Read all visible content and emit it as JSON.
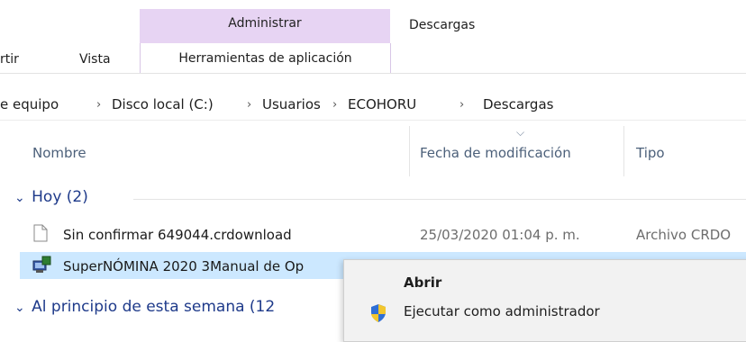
{
  "ribbon": {
    "tab_partial": "rtir",
    "tab_vista": "Vista",
    "context_group": "Administrar",
    "context_tab": "Herramientas de aplicación",
    "window_title": "Descargas"
  },
  "breadcrumb": {
    "items": [
      "e equipo",
      "Disco local (C:)",
      "Usuarios",
      "ECOHORU",
      "Descargas"
    ],
    "separator": "›"
  },
  "columns": {
    "name": "Nombre",
    "date": "Fecha de modificación",
    "type": "Tipo",
    "sort_indicator": "⌵"
  },
  "groups": [
    {
      "label": "Hoy (2)",
      "chevron": "⌄"
    },
    {
      "label": "Al principio de esta semana (12",
      "chevron": "⌄"
    }
  ],
  "files": [
    {
      "name": "Sin confirmar 649044.crdownload",
      "date": "25/03/2020 01:04 p. m.",
      "type": "Archivo CRDO",
      "icon": "document-icon",
      "selected": false
    },
    {
      "name": "SuperNÓMINA 2020 3Manual de Op",
      "date": "",
      "type": "",
      "icon": "installer-icon",
      "selected": true
    }
  ],
  "context_menu": {
    "items": [
      {
        "label": "Abrir",
        "bold": true,
        "icon": ""
      },
      {
        "label": "Ejecutar como administrador",
        "bold": false,
        "icon": "uac-shield-icon"
      }
    ]
  },
  "colors": {
    "context_tab_bg": "#e7d4f3",
    "selection_bg": "#cce8ff",
    "group_text": "#1e3a8a",
    "header_text": "#4c607a"
  }
}
